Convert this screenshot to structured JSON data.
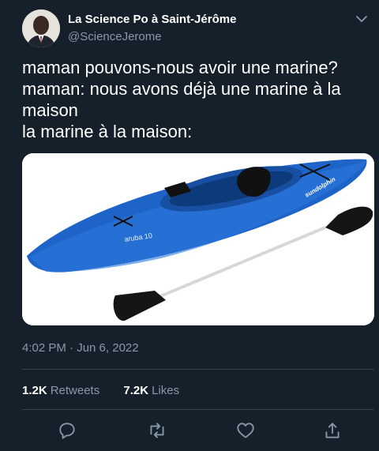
{
  "tweet": {
    "display_name": "La Science Po à Saint-Jérôme",
    "handle": "@ScienceJerome",
    "text": "maman pouvons-nous avoir une marine?\nmaman: nous avons déjà une marine à la maison\nla marine à la maison:",
    "timestamp": "4:02 PM · Jun 6, 2022",
    "media": {
      "kayak_model_text": "aruba 10",
      "kayak_brand_text": "sundolphin"
    },
    "stats": {
      "retweets_count": "1.2K",
      "retweets_label": "Retweets",
      "likes_count": "7.2K",
      "likes_label": "Likes"
    }
  },
  "icons": [
    "caret-down-icon",
    "reply-icon",
    "retweet-icon",
    "like-icon",
    "share-icon"
  ],
  "colors": {
    "background": "#15202b",
    "secondary_text": "#8899a6",
    "divider": "#38444d",
    "kayak_blue": "#1e63c8"
  }
}
